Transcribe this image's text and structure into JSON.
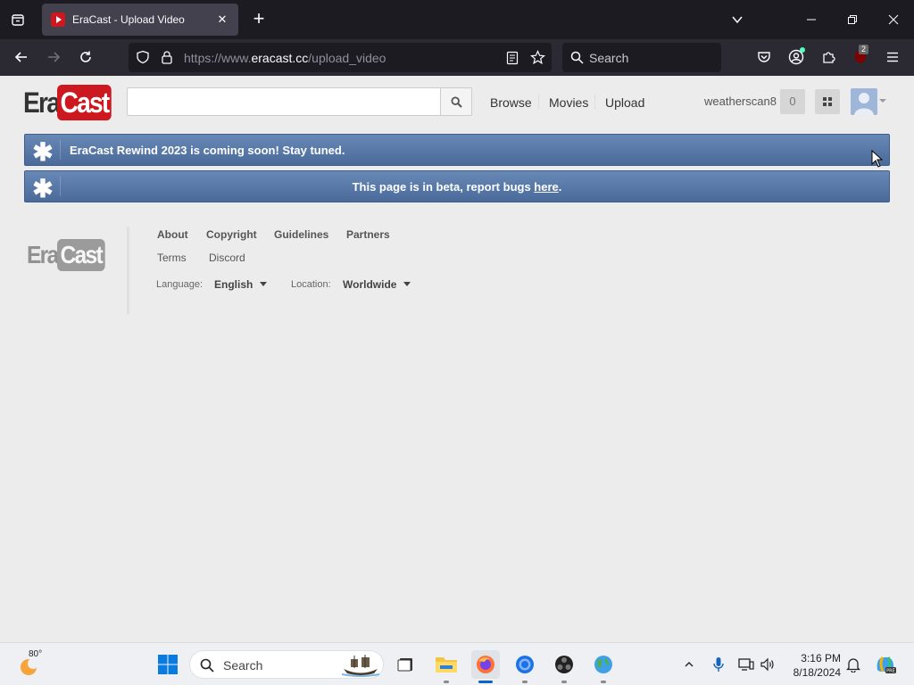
{
  "browser": {
    "tab_title": "EraCast - Upload Video",
    "url_scheme": "https://www.",
    "url_host": "eracast.cc",
    "url_path": "/upload_video",
    "search_placeholder": "Search",
    "extension_badge": "2"
  },
  "site": {
    "logo_era": "Era",
    "logo_cast": "Cast",
    "nav": {
      "browse": "Browse",
      "movies": "Movies",
      "upload": "Upload"
    },
    "username": "weatherscan8",
    "notification_count": "0",
    "alerts": {
      "rewind": "EraCast Rewind 2023 is coming soon! Stay tuned.",
      "beta_prefix": "This page is in beta, report bugs ",
      "beta_link": "here",
      "beta_suffix": "."
    },
    "footer": {
      "links": [
        "About",
        "Copyright",
        "Guidelines",
        "Partners",
        "Terms",
        "Discord"
      ],
      "language_label": "Language:",
      "language_value": "English",
      "location_label": "Location:",
      "location_value": "Worldwide"
    }
  },
  "taskbar": {
    "weather_temp": "80°",
    "search_placeholder": "Search",
    "time": "3:16 PM",
    "date": "8/18/2024"
  }
}
